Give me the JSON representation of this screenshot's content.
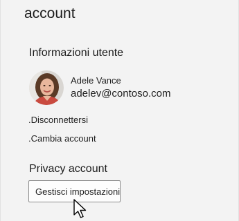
{
  "panel": {
    "title": "account"
  },
  "user_info": {
    "header": "Informazioni utente",
    "name": "Adele Vance",
    "email": "adelev@contoso.com",
    "avatar_icon": "profile-photo"
  },
  "links": {
    "sign_out": ".Disconnettersi",
    "switch_account": ".Cambia account"
  },
  "privacy": {
    "header": "Privacy account",
    "manage_button": "Gestisci impostazioni"
  },
  "cursor_icon": "mouse-pointer-icon"
}
